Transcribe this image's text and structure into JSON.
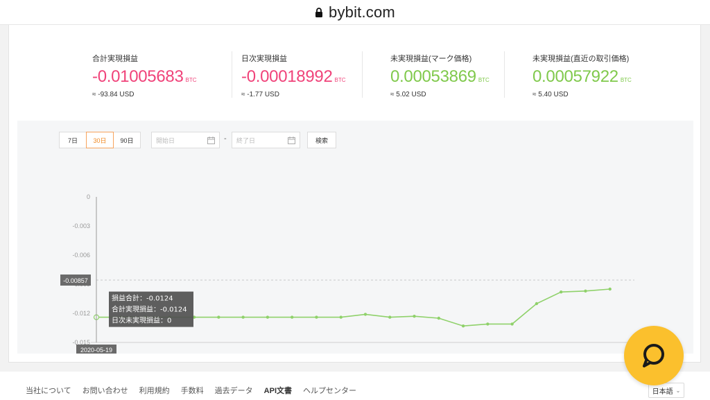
{
  "browser": {
    "url": "bybit.com"
  },
  "stats": [
    {
      "label": "合計実現損益",
      "value": "-0.01005683",
      "unit": "BTC",
      "usd": "≈ -93.84 USD",
      "tone": "neg"
    },
    {
      "label": "日次実現損益",
      "value": "-0.00018992",
      "unit": "BTC",
      "usd": "≈ -1.77 USD",
      "tone": "neg"
    },
    {
      "label": "未実現損益(マーク価格)",
      "value": "0.00053869",
      "unit": "BTC",
      "usd": "≈ 5.02 USD",
      "tone": "pos"
    },
    {
      "label": "未実現損益(直近の取引価格)",
      "value": "0.00057922",
      "unit": "BTC",
      "usd": "≈ 5.40 USD",
      "tone": "pos"
    }
  ],
  "filters": {
    "ranges": [
      "7日",
      "30日",
      "90日"
    ],
    "active_range": "30日",
    "start_placeholder": "開始日",
    "end_placeholder": "終了日",
    "separator": "-",
    "search_label": "検索"
  },
  "chart_data": {
    "type": "line",
    "title": "",
    "xlabel": "",
    "ylabel": "",
    "ylim": [
      -0.015,
      0
    ],
    "yticks": [
      "0",
      "-0.003",
      "-0.006",
      "-0.009",
      "-0.012",
      "-0.015"
    ],
    "reference_line": {
      "value": -0.00857,
      "label": "-0.00857",
      "style": "dashed"
    },
    "series": [
      {
        "color": "#8fd16a",
        "values": [
          -0.0124,
          -0.0124,
          -0.0124,
          -0.0124,
          -0.0124,
          -0.0124,
          -0.0124,
          -0.0124,
          -0.0124,
          -0.0124,
          -0.0124,
          -0.0121,
          -0.0124,
          -0.0123,
          -0.0125,
          -0.0133,
          -0.0131,
          -0.0131,
          -0.011,
          -0.0098,
          -0.0097,
          -0.0095
        ]
      }
    ],
    "crosshair_label": "2020-05-19",
    "tooltip": [
      "損益合計：-0.0124",
      "合計実現損益：-0.0124",
      "日次未実現損益：0"
    ],
    "grid": false
  },
  "footer": {
    "links": [
      "当社について",
      "お問い合わせ",
      "利用規約",
      "手数料",
      "過去データ",
      "API文書",
      "ヘルプセンター"
    ],
    "language": "日本語"
  },
  "colors": {
    "negative": "#f0437a",
    "positive": "#80c94c",
    "accent": "#f08a24",
    "chat": "#fbc02d"
  },
  "icons": {
    "lock": "lock-icon",
    "calendar": "calendar-icon",
    "chat": "chat-icon",
    "chevron": "chevron-down-icon"
  }
}
